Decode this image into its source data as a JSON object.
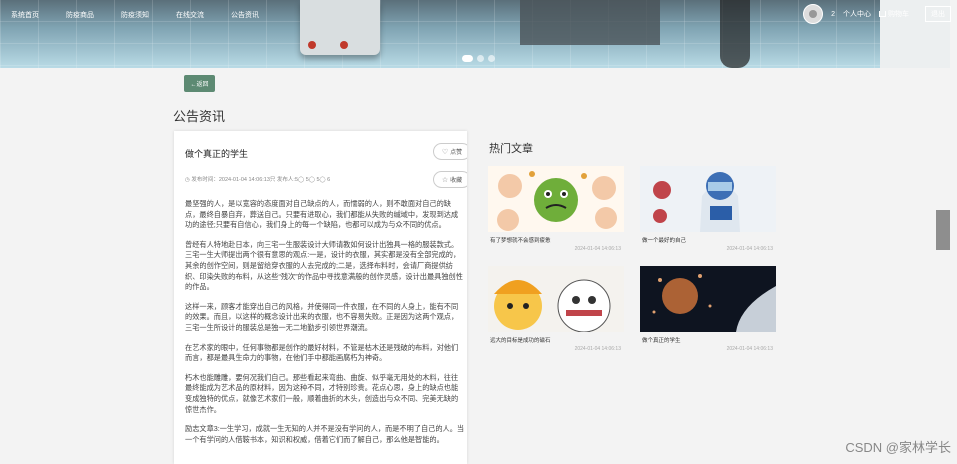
{
  "nav": {
    "items": [
      "系统首页",
      "防疫商品",
      "防疫须知",
      "在线交流",
      "公告资讯"
    ],
    "cart_count": "2",
    "profile_label": "个人中心",
    "cart_label": "购物车",
    "logout_label": "退出"
  },
  "back_label": "←返回",
  "page_title": "公告资讯",
  "article": {
    "title": "做个真正的学生",
    "meta": "◷ 发布时间：2024-01-04 14:06:13只 发布人:5◯ 5◯ 5◯ 6",
    "like_label": "点赞",
    "fav_label": "收藏",
    "paragraphs": [
      "最坚强的人，是以宽容的态度面对自己缺点的人，而懦弱的人，则不敢面对自己的缺点，最终自暴自弃，葬送自己。只要有进取心，我们都能从失败的缄域中，发现到达成功的途径;只要有自信心，我们身上的每一个缺陷，也都可以成为与众不同的优点。",
      "曾经有人特地赴日本，向三宅一生服装设计大师请教如何设计出独具一格的服装款式。三宅一生大师提出两个很有意思的观点:一是，设计的衣服，其实都是没有全部完成的，其余的创作空间，则是留给穿衣服的人去完成的;二是，选择布料时，会请厂商提供纺织、印染失败的布料，从这些“残次”的作品中寻找意满般的创作灵感，设计出最具独创性的作品。",
      "这样一来，顾客才能穿出自己的风格，并使得同一件衣服，在不同的人身上，能有不同的效果。而且，以这样的概念设计出来的衣服，也不容易失败。正是因为这两个观点，三宅一生所设计的服装总是独一无二地勤步引领世界潮流。",
      "在艺术家的眼中，任何事物都是创作的最好材料，不管是枯木还是残破的布料，对他们而言，都是最具生命力的事物，在他们手中都能画腐朽为神奇。",
      "朽木也能雕雕，要何况我们自己。那些看起来弯曲、曲旋、似乎毫无用处的木料，往往最终能成为艺术品的原材料，因为这种不同，才特别珍贵。花点心思，身上的缺点也能变成独特的优点，就像艺术家们一般，顺着曲折的木头，创造出与众不同、完美无缺的惊世杰作。",
      "励志文章3:一生学习，成就一生无知的人并不是没有学问的人，而是不明了自己的人。当一个有学问的人借鞍书本，知识和权威，借着它们而了解自己，那么他是智能的。"
    ]
  },
  "hot": {
    "title": "热门文章",
    "cards": [
      {
        "caption": "有了梦想就不会感到疲惫",
        "date": "2024-01-04 14:06:13"
      },
      {
        "caption": "做一个最好的自己",
        "date": "2024-01-04 14:06:13"
      },
      {
        "caption": "远大的目标是成功的磁石",
        "date": "2024-01-04 14:06:13"
      },
      {
        "caption": "做个真正的学生",
        "date": "2024-01-04 14:06:13"
      }
    ]
  },
  "watermark": "CSDN @家林学长",
  "colors": {
    "accent": "#5d8a73"
  }
}
